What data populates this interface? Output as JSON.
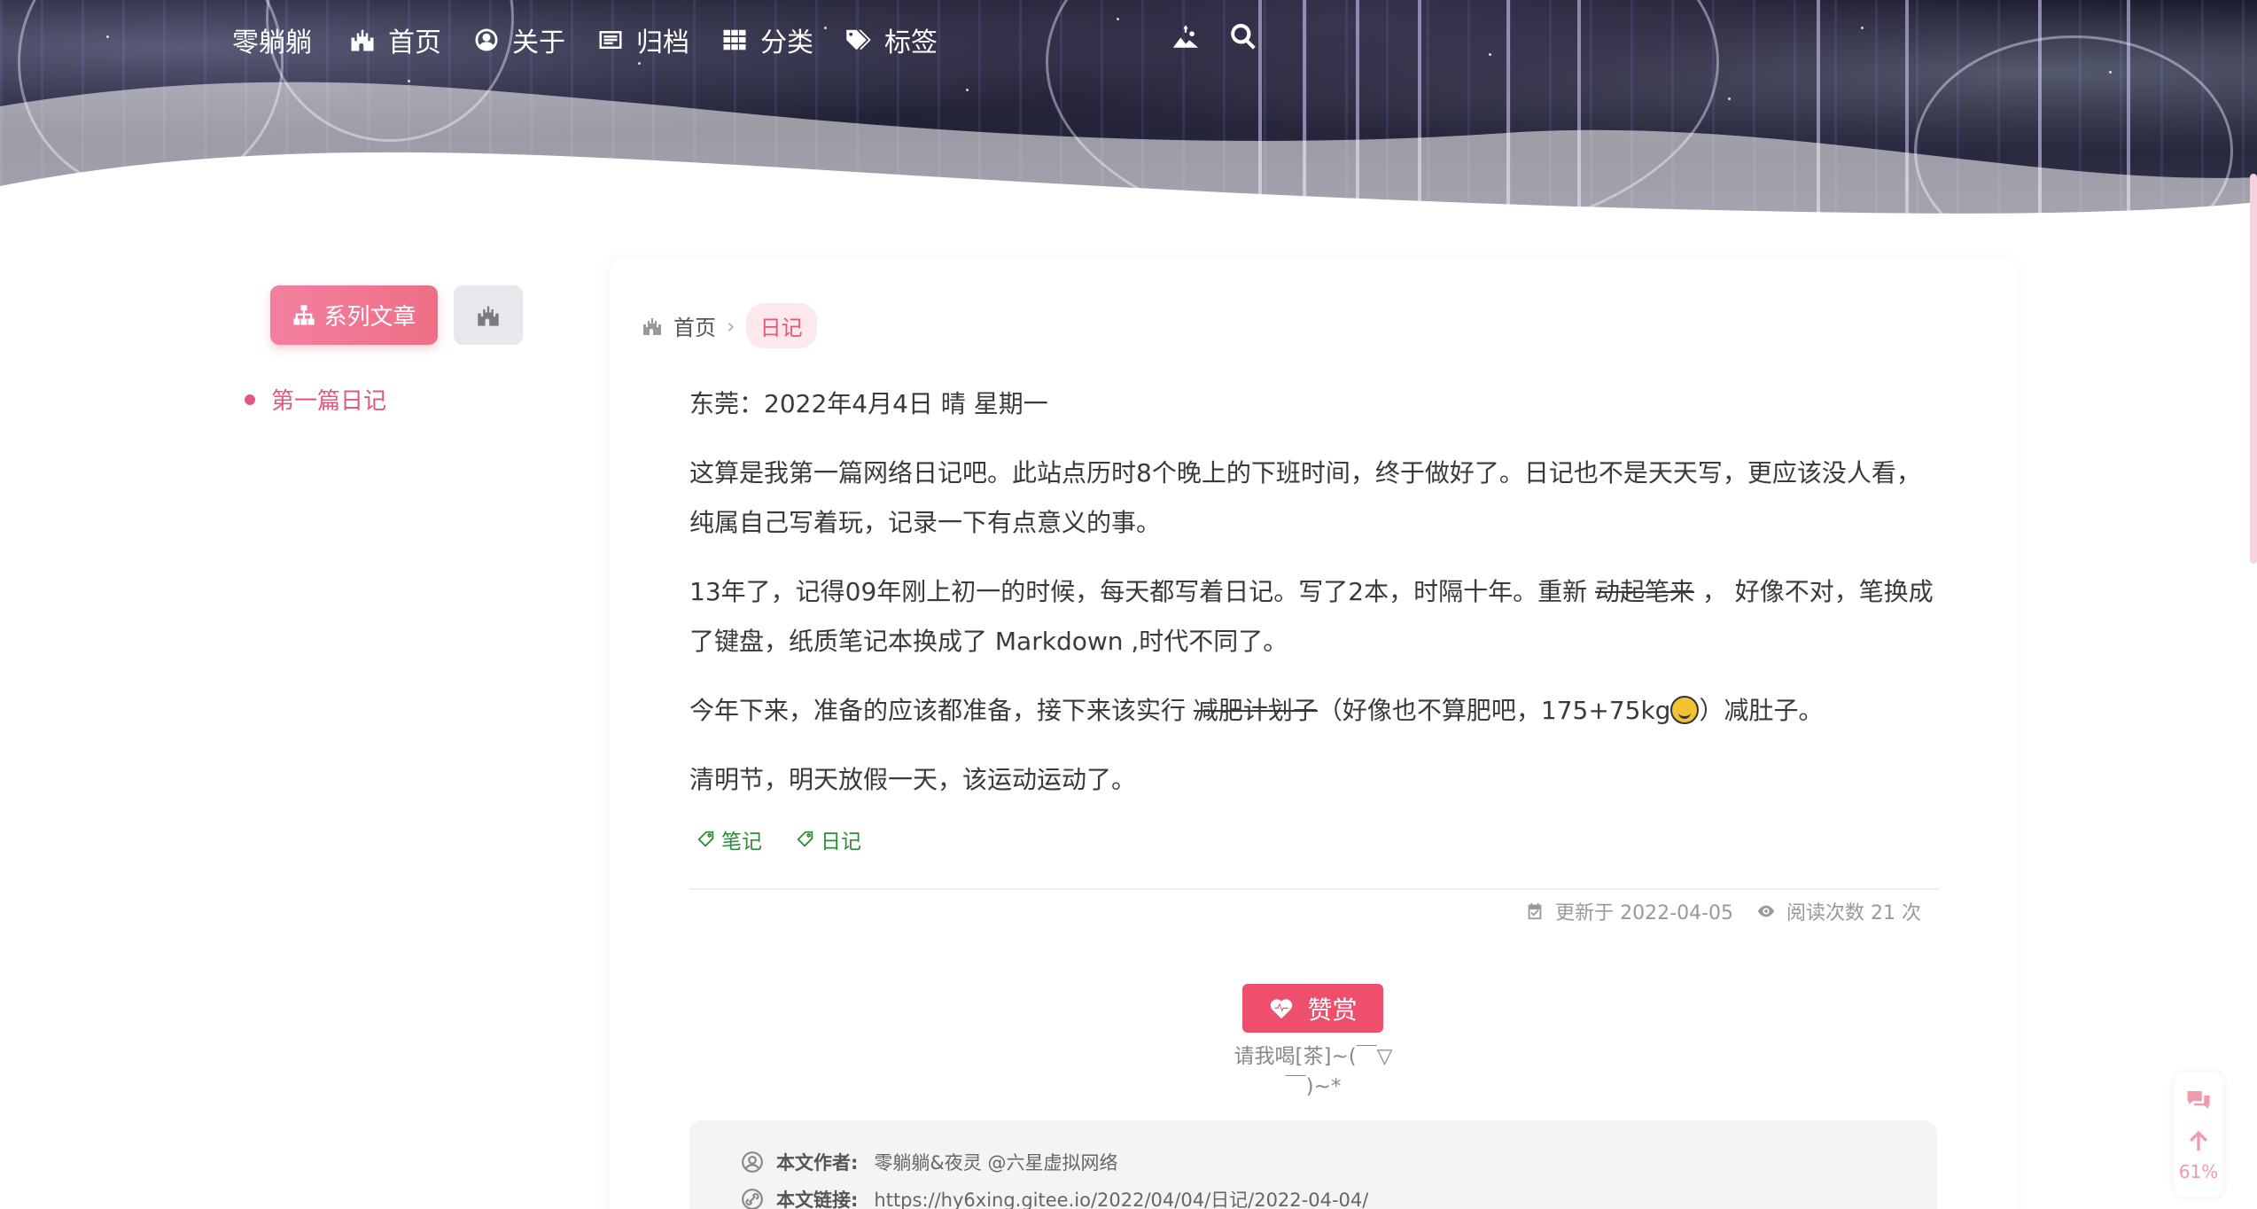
{
  "nav": {
    "brand": "零躺躺",
    "items": [
      {
        "label": "首页",
        "icon": "castle-icon"
      },
      {
        "label": "关于",
        "icon": "user-circle-icon"
      },
      {
        "label": "归档",
        "icon": "archive-icon"
      },
      {
        "label": "分类",
        "icon": "grid-icon"
      },
      {
        "label": "标签",
        "icon": "tags-icon"
      }
    ],
    "right_icons": [
      "landscape-icon",
      "search-icon"
    ]
  },
  "sidebar": {
    "series_tab": "系列文章",
    "series_items": [
      "第一篇日记"
    ]
  },
  "breadcrumb": {
    "home": "首页",
    "current": "日记"
  },
  "article": {
    "date_line": "东莞：2022年4月4日 晴 星期一",
    "p1": "这算是我第一篇网络日记吧。此站点历时8个晚上的下班时间，终于做好了。日记也不是天天写，更应该没人看，纯属自己写着玩，记录一下有点意义的事。",
    "p2_a": "13年了，记得09年刚上初一的时候，每天都写着日记。写了2本，时隔十年。重新 ",
    "p2_strike": "动起笔来",
    "p2_b": " ， 好像不对，笔换成了键盘，纸质笔记本换成了 Markdown ,时代不同了。",
    "p3_a": "今年下来，准备的应该都准备，接下来该实行 ",
    "p3_strike": "减肥计划子",
    "p3_b": "（好像也不算肥吧，175+75kg",
    "p3_c": "）减肚子。",
    "p4": "清明节，明天放假一天，该运动运动了。"
  },
  "tags": [
    "笔记",
    "日记"
  ],
  "meta": {
    "updated": "更新于 2022-04-05",
    "views": "阅读次数 21 次"
  },
  "reward": {
    "label": "赞赏",
    "note": "请我喝[茶]~(￣▽￣)~*"
  },
  "copyright": {
    "author_key": "本文作者:",
    "author_val": "零躺躺&夜灵 @六星虚拟网络",
    "link_key": "本文链接:",
    "link_val": "https://hy6xing.gitee.io/2022/04/04/日记/2022-04-04/"
  },
  "float_tool": {
    "percent": "61%"
  },
  "colors": {
    "accent": "#ee4f6d",
    "series_pink": "#e2587c",
    "tag_green": "#2e8b3a"
  }
}
